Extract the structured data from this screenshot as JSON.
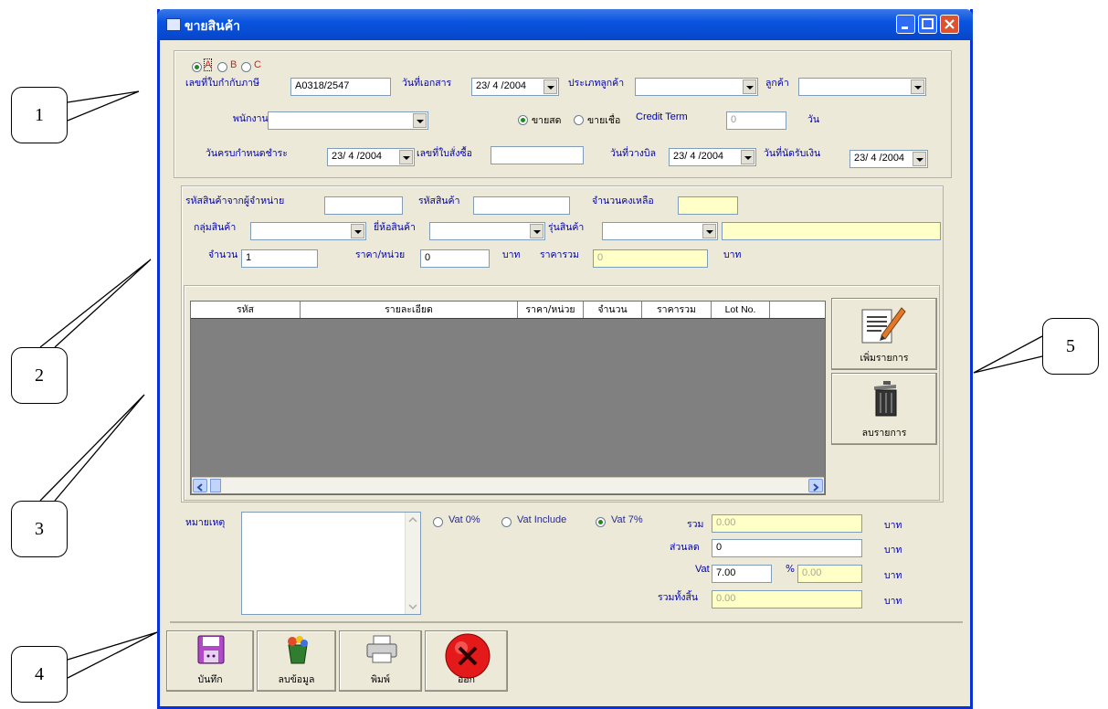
{
  "callouts": [
    "1",
    "2",
    "3",
    "4",
    "5"
  ],
  "window": {
    "title": "ขายสินค้า"
  },
  "titlebar_buttons": [
    "minimize-icon",
    "maximize-icon",
    "close-icon"
  ],
  "header": {
    "tax_type_options": [
      "A",
      "B",
      "C"
    ],
    "tax_type_selected": "A",
    "tax_invoice_label": "เลขที่ใบกำกับภาษี",
    "tax_invoice_value": "A0318/2547",
    "doc_date_label": "วันที่เอกสาร",
    "doc_date_value": "23/ 4 /2004",
    "customer_type_label": "ประเภทลูกค้า",
    "customer_type_value": "",
    "customer_label": "ลูกค้า",
    "customer_value": "",
    "employee_label": "พนักงาน",
    "employee_value": "",
    "sale_cash_label": "ขายสด",
    "sale_credit_label": "ขายเชื่อ",
    "credit_term_label": "Credit Term",
    "credit_term_value": "0",
    "days_label": "วัน",
    "due_date_label": "วันครบกำหนดชำระ",
    "due_date_value": "23/ 4 /2004",
    "po_label": "เลขที่ใบสั่งซื้อ",
    "po_value": "",
    "billing_date_label": "วันที่วางบิล",
    "billing_date_value": "23/ 4 /2004",
    "payment_date_label": "วันที่นัดรับเงิน",
    "payment_date_value": "23/ 4 /2004"
  },
  "item_entry": {
    "supplier_code_label": "รหัสสินค้าจากผู้จำหน่าย",
    "supplier_code_value": "",
    "product_code_label": "รหัสสินค้า",
    "product_code_value": "",
    "stock_label": "จำนวนคงเหลือ",
    "stock_value": "",
    "group_label": "กลุ่มสินค้า",
    "brand_label": "ยี่ห้อสินค้า",
    "model_label": "รุ่นสินค้า",
    "qty_label": "จำนวน",
    "qty_value": "1",
    "unit_price_label": "ราคา/หน่วย",
    "unit_price_value": "0",
    "baht_label": "บาท",
    "total_label": "ราคารวม",
    "total_value": "0"
  },
  "grid": {
    "columns": [
      "รหัส",
      "รายละเอียด",
      "ราคา/หน่วย",
      "จำนวน",
      "ราคารวม",
      "Lot No."
    ]
  },
  "side_buttons": {
    "add": "เพิ่มรายการ",
    "delete": "ลบรายการ"
  },
  "footer": {
    "note_label": "หมายเหตุ",
    "vat_options": [
      "Vat 0%",
      "Vat Include",
      "Vat 7%"
    ],
    "vat_selected": "Vat 7%",
    "sum_label": "รวม",
    "sum_value": "0.00",
    "discount_label": "ส่วนลด",
    "discount_value": "0",
    "vat_label": "Vat",
    "vat_rate": "7.00",
    "percent": "%",
    "vat_amount": "0.00",
    "grand_total_label": "รวมทั้งสิ้น",
    "grand_total_value": "0.00",
    "baht": "บาท"
  },
  "toolbar": {
    "save": "บันทึก",
    "clear": "ลบข้อมูล",
    "print": "พิมพ์",
    "exit": "ออก"
  }
}
